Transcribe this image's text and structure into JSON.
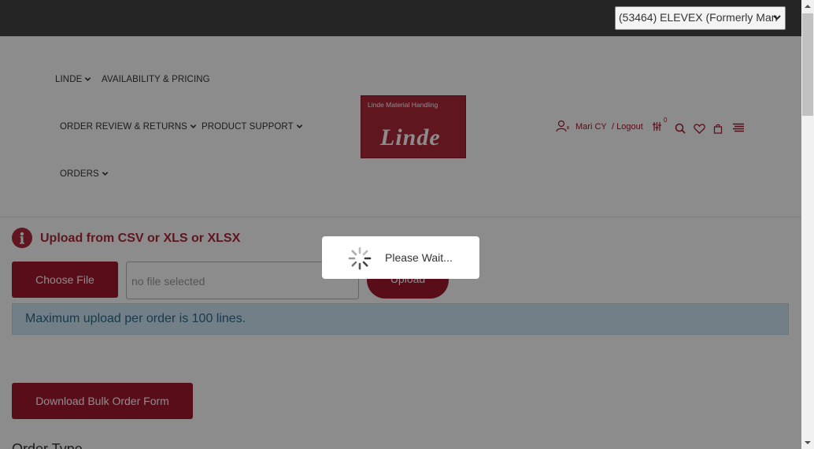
{
  "topbar": {
    "account_select_value": "(53464) ELEVEX (Formerly Man"
  },
  "nav": {
    "items": [
      {
        "label": "LINDE"
      },
      {
        "label": "AVAILABILITY & PRICING"
      },
      {
        "label": "ORDER REVIEW & RETURNS"
      },
      {
        "label": "PRODUCT SUPPORT"
      },
      {
        "label": "ORDERS"
      }
    ]
  },
  "logo": {
    "tagline": "Linde Material Handling",
    "wordmark": "Linde"
  },
  "user": {
    "name": "Mari CY",
    "logout_label": "/ Logout",
    "compare_count": "0"
  },
  "upload": {
    "title": "Upload from CSV or XLS or XLSX",
    "choose_file_label": "Choose File",
    "file_placeholder": "no file selected",
    "upload_label": "Upload",
    "info_text": "Maximum upload per order is 100 lines.",
    "download_label": "Download Bulk Order Form",
    "order_type_label": "Order Type"
  },
  "loading": {
    "text": "Please Wait..."
  },
  "colors": {
    "brand": "#b0283a",
    "brand_dark": "#a0192e",
    "topbar": "#252525",
    "info_bg": "#d2e8f4"
  }
}
